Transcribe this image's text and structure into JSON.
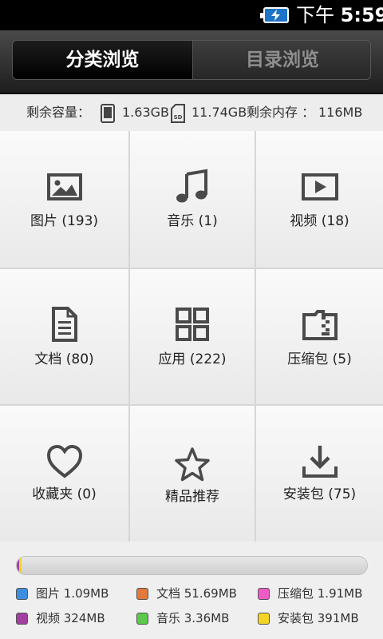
{
  "status_bar": {
    "time_prefix": "下午",
    "time": "5:59"
  },
  "tabs": [
    {
      "label": "分类浏览",
      "active": true
    },
    {
      "label": "目录浏览",
      "active": false
    }
  ],
  "storage": {
    "remaining_label": "剩余容量：",
    "phone_value": "1.63GB",
    "sd_value": "11.74GB",
    "memory_label": "剩余内存 ：",
    "memory_value": "116MB"
  },
  "categories": [
    {
      "label": "图片 (193)",
      "icon": "picture-icon"
    },
    {
      "label": "音乐 (1)",
      "icon": "music-icon"
    },
    {
      "label": "视频 (18)",
      "icon": "video-icon"
    },
    {
      "label": "文档 (80)",
      "icon": "document-icon"
    },
    {
      "label": "应用 (222)",
      "icon": "apps-grid-icon"
    },
    {
      "label": "压缩包 (5)",
      "icon": "archive-icon"
    },
    {
      "label": "收藏夹 (0)",
      "icon": "heart-icon"
    },
    {
      "label": "精品推荐",
      "icon": "star-icon"
    },
    {
      "label": "安装包 (75)",
      "icon": "download-icon"
    }
  ],
  "usage_legend": [
    {
      "label": "图片 1.09MB",
      "color": "#3e8ee0"
    },
    {
      "label": "文档 51.69MB",
      "color": "#e3793a"
    },
    {
      "label": "压缩包 1.91MB",
      "color": "#ee5cc6"
    },
    {
      "label": "视频 324MB",
      "color": "#a23fa0"
    },
    {
      "label": "音乐 3.36MB",
      "color": "#5cc94a"
    },
    {
      "label": "安装包 391MB",
      "color": "#f3d426"
    }
  ],
  "usage_bar": [
    {
      "color": "#a23fa0",
      "fraction": 0.006
    },
    {
      "color": "#f3d426",
      "fraction": 0.008
    }
  ]
}
